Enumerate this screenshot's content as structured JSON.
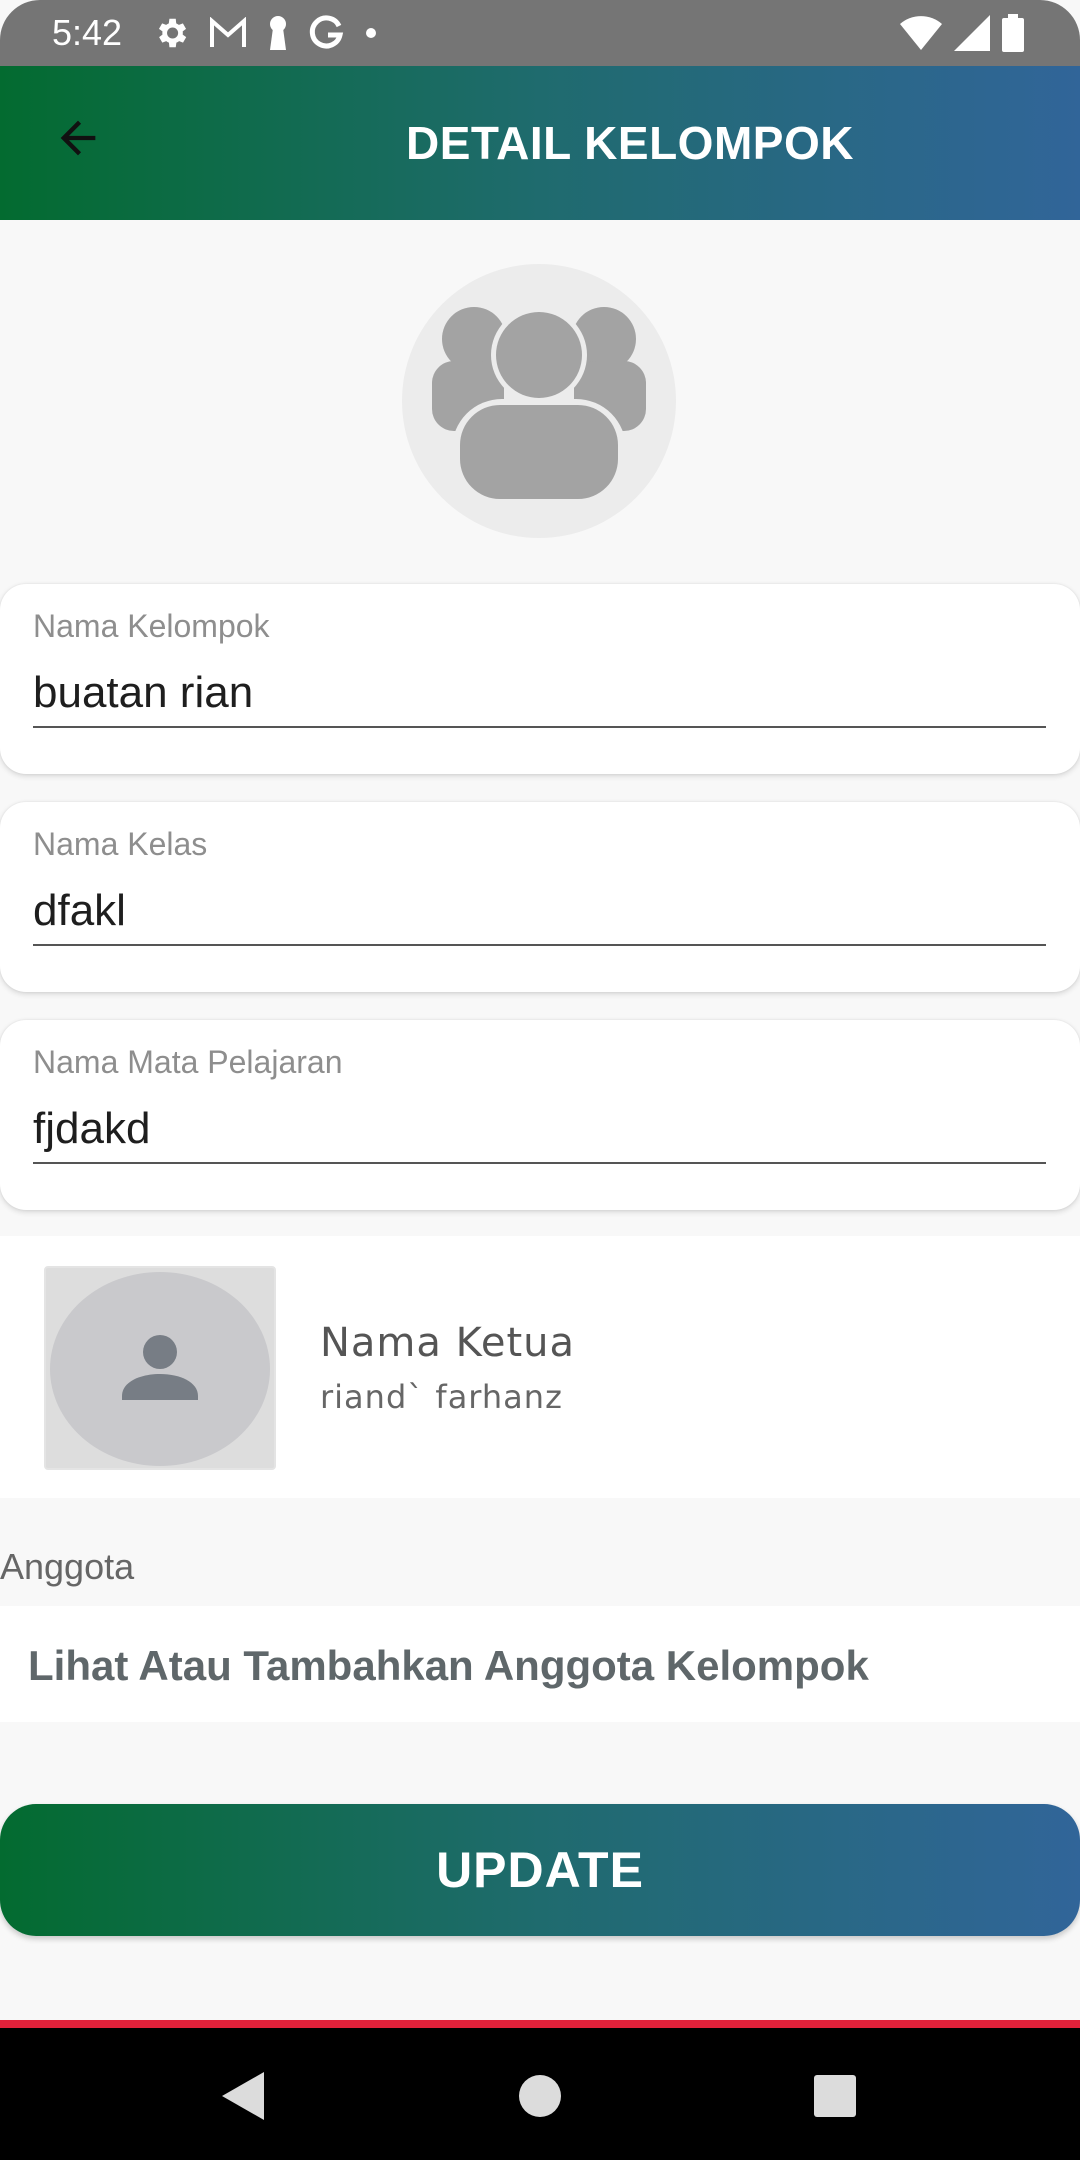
{
  "status_bar": {
    "time": "5:42",
    "left_icons": [
      "settings-icon",
      "gmail-icon",
      "keyhole-icon",
      "google-icon",
      "dot-icon"
    ],
    "right_icons": [
      "wifi-icon",
      "signal-icon",
      "battery-icon"
    ]
  },
  "header": {
    "title": "DETAIL KELOMPOK",
    "back_icon": "arrow-back-icon"
  },
  "group_avatar_icon": "group-people-icon",
  "form": {
    "group_name": {
      "label": "Nama Kelompok",
      "value": "buatan rian"
    },
    "class_name": {
      "label": "Nama Kelas",
      "value": "dfakl"
    },
    "subject_name": {
      "label": "Nama Mata Pelajaran",
      "value": "fjdakd"
    }
  },
  "leader": {
    "title": "Nama Ketua",
    "name": "riand` farhanz",
    "photo_icon": "person-icon"
  },
  "members": {
    "label": "Anggota",
    "link_text": "Lihat Atau Tambahkan Anggota Kelompok"
  },
  "update_button": {
    "label": "UPDATE"
  },
  "nav_bar": {
    "icons": [
      "nav-back-icon",
      "nav-home-icon",
      "nav-recents-icon"
    ]
  },
  "colors": {
    "gradient_start": "#036b30",
    "gradient_mid": "#1f6b6e",
    "gradient_end": "#316599",
    "accent_red": "#e0213a"
  }
}
